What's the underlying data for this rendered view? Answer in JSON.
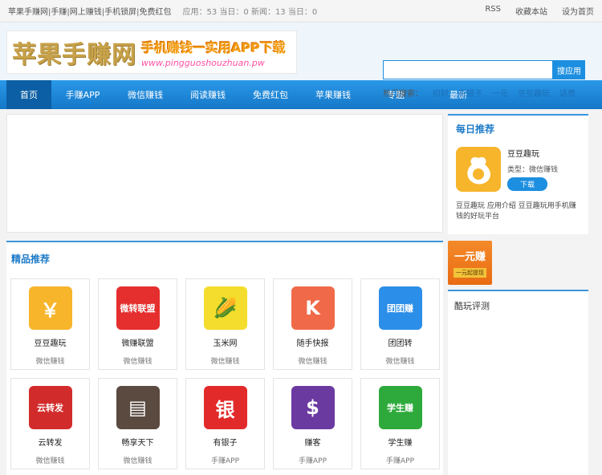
{
  "topbar": {
    "links": [
      "苹果手赚网",
      "手赚",
      "网上赚钱",
      "手机锁屏",
      "免费红包"
    ],
    "stats": "应用：53 当日：0 新闻：13 当日：0",
    "right": [
      "RSS",
      "收藏本站",
      "设为首页"
    ]
  },
  "logo": {
    "main": "苹果手赚网",
    "slogan": "手机赚钱一实用APP下载",
    "url": "www.pingguoshouzhuan.pw"
  },
  "search": {
    "placeholder": "",
    "button": "搜应用"
  },
  "hot": {
    "label": "热门搜索：",
    "items": [
      "招财",
      "有银子",
      "一元",
      "豆豆趣玩",
      "话费"
    ]
  },
  "nav": [
    "首页",
    "手赚APP",
    "微信赚钱",
    "阅读赚钱",
    "免费红包",
    "苹果赚钱",
    "专题",
    "最新"
  ],
  "section": {
    "title": "精品推荐"
  },
  "apps": [
    {
      "name": "豆豆趣玩",
      "cat": "微信赚钱",
      "icon": "coin-bag-icon",
      "color": "#f7b52c",
      "glyph": "￥"
    },
    {
      "name": "微赚联盟",
      "cat": "微信赚钱",
      "icon": "weizhuan-icon",
      "color": "#e52e2e",
      "glyph": "微转联盟"
    },
    {
      "name": "玉米网",
      "cat": "微信赚钱",
      "icon": "corn-icon",
      "color": "#f4dd2c",
      "glyph": "🌽"
    },
    {
      "name": "随手快报",
      "cat": "微信赚钱",
      "icon": "k-logo-icon",
      "color": "#f06a4a",
      "glyph": "K"
    },
    {
      "name": "团团转",
      "cat": "微信赚钱",
      "icon": "tuantuan-icon",
      "color": "#2b8ee8",
      "glyph": "团团赚"
    },
    {
      "name": "云转发",
      "cat": "微信赚钱",
      "icon": "yunzhuan-icon",
      "color": "#d22b2b",
      "glyph": "云转发"
    },
    {
      "name": "畅享天下",
      "cat": "微信赚钱",
      "icon": "document-icon",
      "color": "#5a4a40",
      "glyph": "▤"
    },
    {
      "name": "有银子",
      "cat": "手赚APP",
      "icon": "yin-icon",
      "color": "#e22a2a",
      "glyph": "银"
    },
    {
      "name": "赚客",
      "cat": "手赚APP",
      "icon": "businessman-icon",
      "color": "#6b3aa0",
      "glyph": "$"
    },
    {
      "name": "学生赚",
      "cat": "手赚APP",
      "icon": "frog-icon",
      "color": "#2eaa3c",
      "glyph": "学生赚"
    }
  ],
  "daily": {
    "title": "每日推荐",
    "name": "豆豆趣玩",
    "type": "类型：微信赚钱",
    "button": "下载",
    "desc": "豆豆趣玩 应用介绍 豆豆趣玩用手机赚钱的好玩平台"
  },
  "ad": {
    "big": "一元赚",
    "small": "一元起提现"
  },
  "review": {
    "title": "酷玩评测"
  }
}
